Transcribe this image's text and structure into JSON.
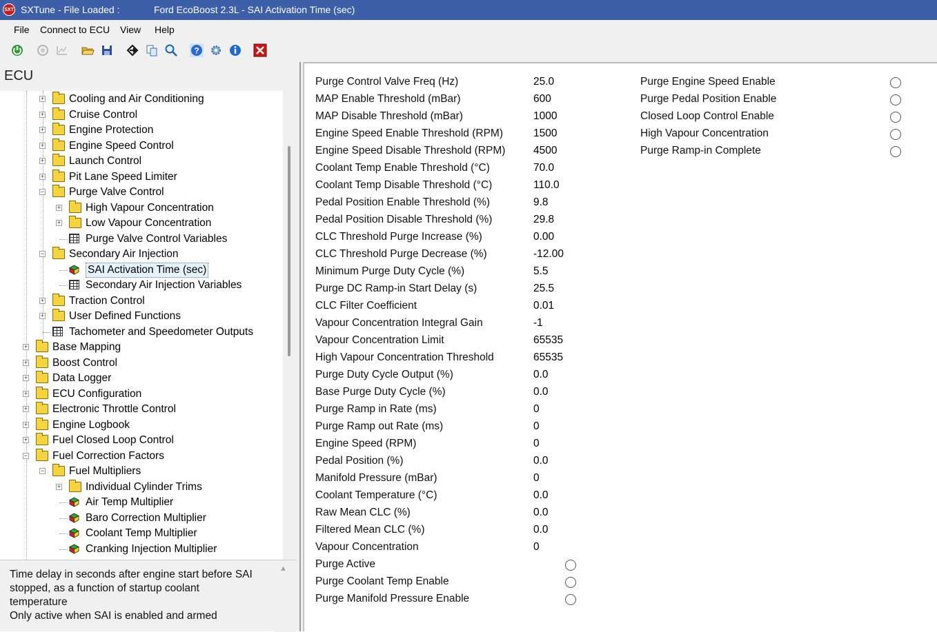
{
  "titlebar": {
    "logo": "SXT",
    "app": "SXTune - File Loaded :",
    "file": "Ford EcoBoost 2.3L  - SAI Activation Time (sec)"
  },
  "menu": [
    "File",
    "Connect to ECU",
    "View",
    "Help"
  ],
  "toolbar_icons": [
    "power-icon",
    "disconnect-icon",
    "chart-icon",
    "open-folder-icon",
    "save-icon",
    "goto-icon",
    "copy-icon",
    "search-icon",
    "help-icon",
    "settings-icon",
    "info-icon",
    "close-icon"
  ],
  "left": {
    "title": "ECU",
    "tree": [
      {
        "label": "Cooling and Air Conditioning",
        "level": 2,
        "type": "folder",
        "exp": "+"
      },
      {
        "label": "Cruise Control",
        "level": 2,
        "type": "folder",
        "exp": "+"
      },
      {
        "label": "Engine Protection",
        "level": 2,
        "type": "folder",
        "exp": "+"
      },
      {
        "label": "Engine Speed Control",
        "level": 2,
        "type": "folder",
        "exp": "+"
      },
      {
        "label": "Launch Control",
        "level": 2,
        "type": "folder",
        "exp": "+"
      },
      {
        "label": "Pit Lane Speed Limiter",
        "level": 2,
        "type": "folder",
        "exp": "+"
      },
      {
        "label": "Purge Valve Control",
        "level": 2,
        "type": "folder",
        "exp": "-"
      },
      {
        "label": "High Vapour Concentration",
        "level": 3,
        "type": "folder",
        "exp": "+"
      },
      {
        "label": "Low Vapour Concentration",
        "level": 3,
        "type": "folder",
        "exp": "+"
      },
      {
        "label": "Purge Valve Control Variables",
        "level": 3,
        "type": "grid",
        "exp": ""
      },
      {
        "label": "Secondary Air Injection",
        "level": 2,
        "type": "folder",
        "exp": "-"
      },
      {
        "label": "SAI Activation Time (sec)",
        "level": 3,
        "type": "cube",
        "exp": "",
        "selected": true
      },
      {
        "label": "Secondary Air Injection Variables",
        "level": 3,
        "type": "grid",
        "exp": ""
      },
      {
        "label": "Traction Control",
        "level": 2,
        "type": "folder",
        "exp": "+"
      },
      {
        "label": "User Defined Functions",
        "level": 2,
        "type": "folder",
        "exp": "+"
      },
      {
        "label": "Tachometer and Speedometer Outputs",
        "level": 2,
        "type": "grid",
        "exp": ""
      },
      {
        "label": "Base Mapping",
        "level": 1,
        "type": "folder",
        "exp": "+"
      },
      {
        "label": "Boost Control",
        "level": 1,
        "type": "folder",
        "exp": "+"
      },
      {
        "label": "Data Logger",
        "level": 1,
        "type": "folder",
        "exp": "+"
      },
      {
        "label": "ECU Configuration",
        "level": 1,
        "type": "folder",
        "exp": "+"
      },
      {
        "label": "Electronic Throttle Control",
        "level": 1,
        "type": "folder",
        "exp": "+"
      },
      {
        "label": "Engine Logbook",
        "level": 1,
        "type": "folder",
        "exp": "+"
      },
      {
        "label": "Fuel Closed Loop Control",
        "level": 1,
        "type": "folder",
        "exp": "+"
      },
      {
        "label": "Fuel Correction Factors",
        "level": 1,
        "type": "folder",
        "exp": "-"
      },
      {
        "label": "Fuel Multipliers",
        "level": 2,
        "type": "folder",
        "exp": "-"
      },
      {
        "label": "Individual Cylinder Trims",
        "level": 3,
        "type": "folder",
        "exp": "+"
      },
      {
        "label": "Air Temp Multiplier",
        "level": 3,
        "type": "cube",
        "exp": ""
      },
      {
        "label": "Baro Correction Multiplier",
        "level": 3,
        "type": "cube",
        "exp": ""
      },
      {
        "label": "Coolant Temp Multiplier",
        "level": 3,
        "type": "cube",
        "exp": ""
      },
      {
        "label": "Cranking Injection Multiplier",
        "level": 3,
        "type": "cube",
        "exp": ""
      }
    ],
    "description": [
      "Time delay in seconds after engine start before SAI",
      "stopped, as a function of startup coolant",
      "temperature",
      "Only active when SAI is enabled and armed"
    ]
  },
  "params": [
    {
      "label": "Purge Control Valve Freq (Hz)",
      "value": "25.0"
    },
    {
      "label": "MAP Enable Threshold (mBar)",
      "value": "600"
    },
    {
      "label": "MAP Disable Threshold (mBar)",
      "value": "1000"
    },
    {
      "label": "Engine Speed Enable Threshold (RPM)",
      "value": "1500"
    },
    {
      "label": "Engine Speed Disable Threshold (RPM)",
      "value": "4500"
    },
    {
      "label": "Coolant Temp Enable Threshold (°C)",
      "value": "70.0"
    },
    {
      "label": "Coolant Temp Disable Threshold (°C)",
      "value": "110.0"
    },
    {
      "label": "Pedal Position Enable Threshold (%)",
      "value": "9.8"
    },
    {
      "label": "Pedal Position Disable Threshold (%)",
      "value": "29.8"
    },
    {
      "label": "CLC Threshold Purge Increase (%)",
      "value": "0.00"
    },
    {
      "label": "CLC Threshold Purge Decrease (%)",
      "value": "-12.00"
    },
    {
      "label": "Minimum Purge Duty Cycle (%)",
      "value": "5.5"
    },
    {
      "label": "Purge DC Ramp-in Start Delay (s)",
      "value": "25.5"
    },
    {
      "label": "CLC Filter Coefficient",
      "value": "0.01"
    },
    {
      "label": "Vapour Concentration Integral Gain",
      "value": "-1"
    },
    {
      "label": "Vapour Concentration Limit",
      "value": "65535"
    },
    {
      "label": "High Vapour Concentration Threshold",
      "value": "65535"
    },
    {
      "label": "Purge Duty Cycle Output (%)",
      "value": "0.0"
    },
    {
      "label": "Base Purge Duty Cycle (%)",
      "value": "0.0"
    },
    {
      "label": "Purge Ramp in Rate (ms)",
      "value": "0"
    },
    {
      "label": "Purge Ramp out Rate (ms)",
      "value": "0"
    },
    {
      "label": "Engine Speed (RPM)",
      "value": "0"
    },
    {
      "label": "Pedal Position (%)",
      "value": "0.0"
    },
    {
      "label": "Manifold Pressure (mBar)",
      "value": "0"
    },
    {
      "label": "Coolant Temperature (°C)",
      "value": "0.0"
    },
    {
      "label": "Raw Mean CLC (%)",
      "value": "0.0"
    },
    {
      "label": "Filtered Mean CLC (%)",
      "value": "0.0"
    },
    {
      "label": "Vapour Concentration",
      "value": "0"
    }
  ],
  "flags_left": [
    {
      "label": "Purge Active",
      "checked": false
    },
    {
      "label": "Purge Coolant Temp Enable",
      "checked": false
    },
    {
      "label": "Purge Manifold Pressure Enable",
      "checked": false
    }
  ],
  "flags_right": [
    {
      "label": "Purge Engine Speed Enable",
      "checked": false
    },
    {
      "label": "Purge Pedal Position Enable",
      "checked": false
    },
    {
      "label": "Closed Loop Control Enable",
      "checked": false
    },
    {
      "label": "High Vapour Concentration",
      "checked": false
    },
    {
      "label": "Purge Ramp-in Complete",
      "checked": false
    }
  ]
}
